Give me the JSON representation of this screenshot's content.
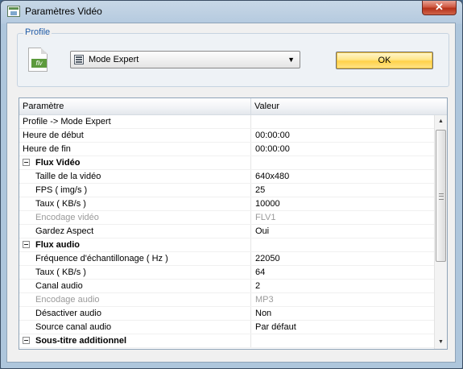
{
  "window": {
    "title": "Paramètres Vidéo",
    "close_label": "✕"
  },
  "profile": {
    "legend": "Profile",
    "icon_badge": "flv",
    "selected": "Mode Expert",
    "ok_label": "OK"
  },
  "grid": {
    "col_param": "Paramètre",
    "col_value": "Valeur",
    "rows": [
      {
        "label": "Profile -> Mode Expert",
        "value": "",
        "kind": "plain"
      },
      {
        "label": "Heure de début",
        "value": "00:00:00",
        "kind": "plain"
      },
      {
        "label": "Heure de fin",
        "value": "00:00:00",
        "kind": "plain"
      },
      {
        "label": "Flux Vidéo",
        "value": "",
        "kind": "group"
      },
      {
        "label": "Taille de la vidéo",
        "value": "640x480",
        "kind": "child"
      },
      {
        "label": "FPS ( img/s )",
        "value": "25",
        "kind": "child"
      },
      {
        "label": "Taux ( KB/s )",
        "value": "10000",
        "kind": "child"
      },
      {
        "label": "Encodage vidéo",
        "value": "FLV1",
        "kind": "child-disabled"
      },
      {
        "label": "Gardez Aspect",
        "value": "Oui",
        "kind": "child"
      },
      {
        "label": "Flux audio",
        "value": "",
        "kind": "group"
      },
      {
        "label": "Fréquence d'échantillonage ( Hz )",
        "value": "22050",
        "kind": "child"
      },
      {
        "label": "Taux ( KB/s )",
        "value": "64",
        "kind": "child"
      },
      {
        "label": "Canal audio",
        "value": "2",
        "kind": "child"
      },
      {
        "label": "Encodage audio",
        "value": "MP3",
        "kind": "child-disabled"
      },
      {
        "label": "Désactiver audio",
        "value": "Non",
        "kind": "child"
      },
      {
        "label": "Source canal audio",
        "value": "Par défaut",
        "kind": "child"
      },
      {
        "label": "Sous-titre additionnel",
        "value": "",
        "kind": "group"
      }
    ]
  },
  "scrollbar": {
    "up_icon": "scroll-up-arrow-icon",
    "down_icon": "scroll-down-arrow-icon"
  }
}
